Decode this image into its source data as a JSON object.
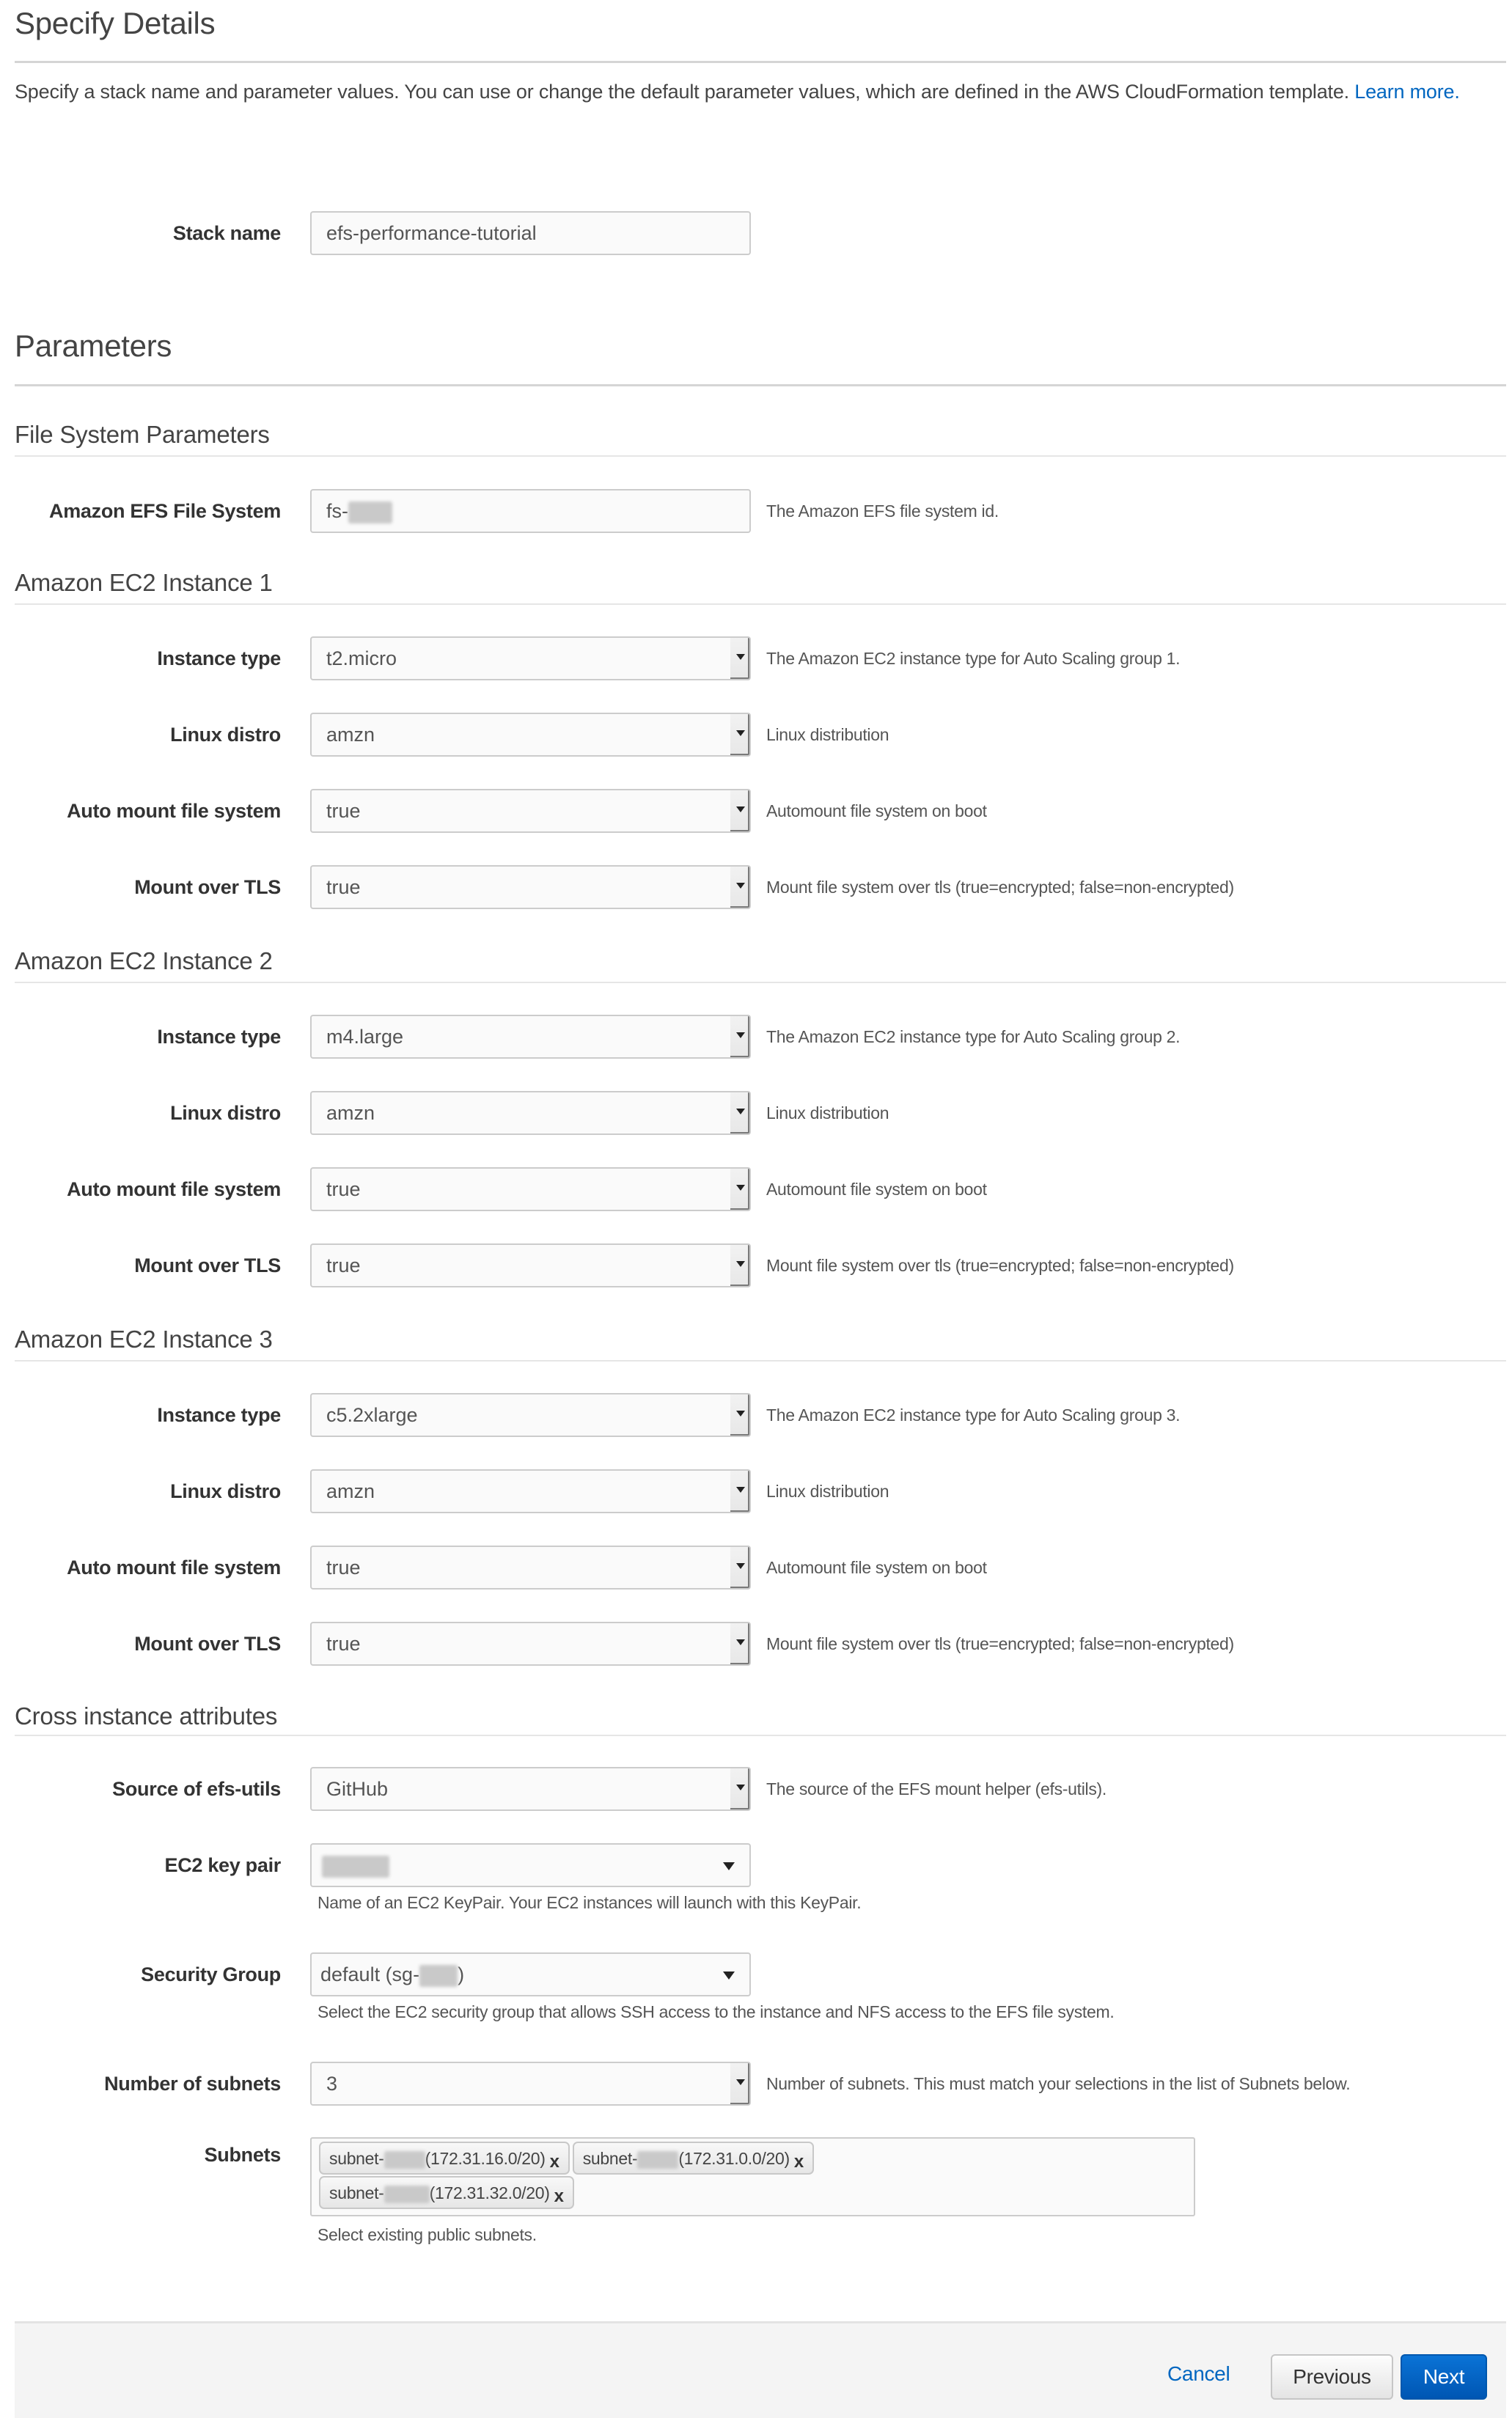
{
  "page": {
    "title": "Specify Details",
    "intro_text": "Specify a stack name and parameter values. You can use or change the default parameter values, which are defined in the AWS CloudFormation template. ",
    "learn_more_link": "Learn more."
  },
  "stack": {
    "label": "Stack name",
    "value": "efs-performance-tutorial"
  },
  "parameters": {
    "heading": "Parameters",
    "file_system": {
      "heading": "File System Parameters",
      "efs": {
        "label": "Amazon EFS File System",
        "value_prefix": "fs-",
        "value_redacted": true,
        "help": "The Amazon EFS file system id."
      }
    },
    "instances": [
      {
        "heading": "Amazon EC2 Instance 1",
        "instance_type": {
          "label": "Instance type",
          "value": "t2.micro",
          "help": "The Amazon EC2 instance type for Auto Scaling group 1."
        },
        "linux_distro": {
          "label": "Linux distro",
          "value": "amzn",
          "help": "Linux distribution"
        },
        "auto_mount": {
          "label": "Auto mount file system",
          "value": "true",
          "help": "Automount file system on boot"
        },
        "mount_tls": {
          "label": "Mount over TLS",
          "value": "true",
          "help": "Mount file system over tls (true=encrypted; false=non-encrypted)"
        }
      },
      {
        "heading": "Amazon EC2 Instance 2",
        "instance_type": {
          "label": "Instance type",
          "value": "m4.large",
          "help": "The Amazon EC2 instance type for Auto Scaling group 2."
        },
        "linux_distro": {
          "label": "Linux distro",
          "value": "amzn",
          "help": "Linux distribution"
        },
        "auto_mount": {
          "label": "Auto mount file system",
          "value": "true",
          "help": "Automount file system on boot"
        },
        "mount_tls": {
          "label": "Mount over TLS",
          "value": "true",
          "help": "Mount file system over tls (true=encrypted; false=non-encrypted)"
        }
      },
      {
        "heading": "Amazon EC2 Instance 3",
        "instance_type": {
          "label": "Instance type",
          "value": "c5.2xlarge",
          "help": "The Amazon EC2 instance type for Auto Scaling group 3."
        },
        "linux_distro": {
          "label": "Linux distro",
          "value": "amzn",
          "help": "Linux distribution"
        },
        "auto_mount": {
          "label": "Auto mount file system",
          "value": "true",
          "help": "Automount file system on boot"
        },
        "mount_tls": {
          "label": "Mount over TLS",
          "value": "true",
          "help": "Mount file system over tls (true=encrypted; false=non-encrypted)"
        }
      }
    ],
    "cross": {
      "heading": "Cross instance attributes",
      "efs_utils_source": {
        "label": "Source of efs-utils",
        "value": "GitHub",
        "help": "The source of the EFS mount helper (efs-utils)."
      },
      "key_pair": {
        "label": "EC2 key pair",
        "value_redacted": true,
        "help": "Name of an EC2 KeyPair. Your EC2 instances will launch with this KeyPair."
      },
      "security_group": {
        "label": "Security Group",
        "value_prefix": "default (sg-",
        "value_suffix": ")",
        "value_redacted": true,
        "help": "Select the EC2 security group that allows SSH access to the instance and NFS access to the EFS file system."
      },
      "num_subnets": {
        "label": "Number of subnets",
        "value": "3",
        "help": "Number of subnets. This must match your selections in the list of Subnets below."
      },
      "subnets": {
        "label": "Subnets",
        "help": "Select existing public subnets.",
        "remove_glyph": "x",
        "items": [
          {
            "prefix": "subnet-",
            "cidr": "(172.31.16.0/20)"
          },
          {
            "prefix": "subnet-",
            "cidr": "(172.31.0.0/20)"
          },
          {
            "prefix": "subnet-",
            "cidr": "(172.31.32.0/20)"
          }
        ]
      }
    }
  },
  "footer": {
    "cancel_label": "Cancel",
    "previous_label": "Previous",
    "next_label": "Next"
  },
  "colors": {
    "link": "#0066c0",
    "primary_button": "#0066c0",
    "text": "#444444"
  }
}
